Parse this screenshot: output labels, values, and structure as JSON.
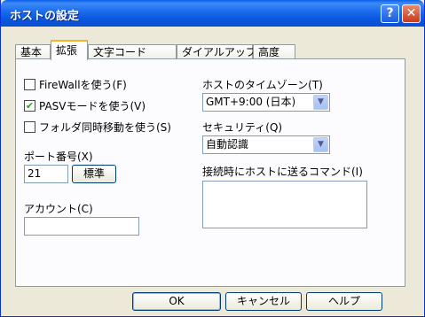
{
  "window": {
    "title": "ホストの設定",
    "help_glyph": "?",
    "close_glyph": "✕"
  },
  "tabs": [
    "基本",
    "拡張",
    "文字コード",
    "ダイアルアップ",
    "高度"
  ],
  "options": {
    "firewall": {
      "label": "FireWallを使う(F)",
      "checked": false
    },
    "pasv": {
      "label": "PASVモードを使う(V)",
      "checked": true
    },
    "sync_move": {
      "label": "フォルダ同時移動を使う(S)",
      "checked": false
    }
  },
  "port": {
    "label": "ポート番号(X)",
    "value": "21",
    "default_button": "標準"
  },
  "account": {
    "label": "アカウント(C)",
    "value": ""
  },
  "timezone": {
    "label": "ホストのタイムゾーン(T)",
    "value": "GMT+9:00 (日本)"
  },
  "security": {
    "label": "セキュリティ(Q)",
    "value": "自動認識"
  },
  "command": {
    "label": "接続時にホストに送るコマンド(I)",
    "value": ""
  },
  "buttons": {
    "ok": "OK",
    "cancel": "キャンセル",
    "help": "ヘルプ"
  },
  "check_glyph": "✔"
}
